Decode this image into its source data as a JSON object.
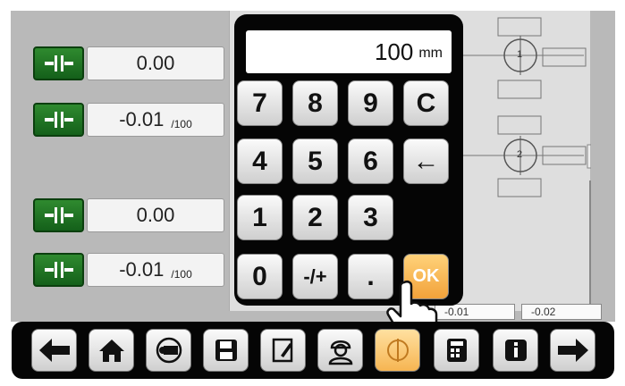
{
  "left_rows": [
    {
      "value": "0.00",
      "unit": ""
    },
    {
      "value": "-0.01",
      "unit": "/100"
    },
    {
      "value": "0.00",
      "unit": ""
    },
    {
      "value": "-0.01",
      "unit": "/100"
    }
  ],
  "keypad": {
    "display_value": "100",
    "display_unit": "mm",
    "keys": [
      "7",
      "8",
      "9",
      "C",
      "4",
      "5",
      "6",
      "←",
      "1",
      "2",
      "3",
      "0",
      "-/+",
      ".",
      "OK"
    ]
  },
  "diagram": {
    "marker1": "1",
    "marker2": "2"
  },
  "bottom_values": [
    "-0.01",
    "-0.02"
  ],
  "toolbar_icons": [
    "arrow-left-icon",
    "home-icon",
    "rotate-view-icon",
    "save-icon",
    "edit-icon",
    "operator-icon",
    "touch-target-icon",
    "calculator-icon",
    "info-icon",
    "arrow-right-icon"
  ],
  "colors": {
    "green": "#1f7a22",
    "ok": "#f2a23a",
    "black": "#050505"
  }
}
